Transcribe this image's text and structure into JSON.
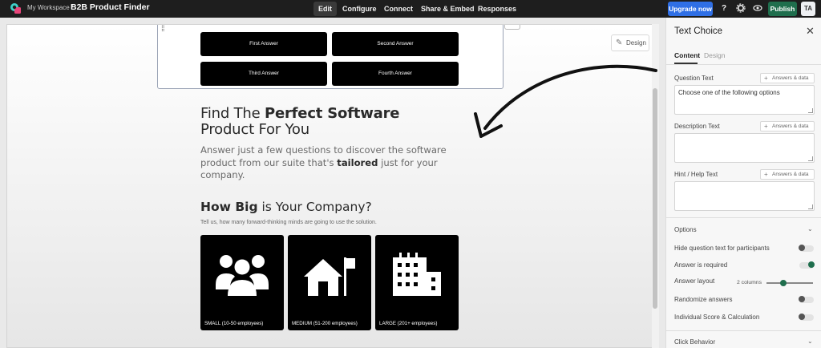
{
  "topbar": {
    "workspace": "My Workspace /",
    "title": "B2B Product Finder",
    "nav": [
      {
        "label": "Edit",
        "active": true
      },
      {
        "label": "Configure",
        "active": false
      },
      {
        "label": "Connect",
        "active": false
      },
      {
        "label": "Share & Embed",
        "active": false
      },
      {
        "label": "Responses",
        "active": false
      }
    ],
    "upgrade_label": "Upgrade now",
    "help_icon": "question-icon",
    "settings_icon": "gear-icon",
    "preview_icon": "eye-icon",
    "publish_label": "Publish",
    "avatar_initials": "TA",
    "accent_color": "#2f6fe5",
    "publish_color": "#1f6e4d"
  },
  "canvas": {
    "answers": [
      "First Answer",
      "Second Answer",
      "Third Answer",
      "Fourth Answer"
    ],
    "design_label": "Design",
    "headline_pre": "Find The ",
    "headline_bold": "Perfect Software",
    "headline_post": "Product For You",
    "subhead_pre": "Answer just a few questions to discover the software product from our suite that's ",
    "subhead_bold": "tailored",
    "subhead_post": " just for your company.",
    "question_bold": "How Big",
    "question_rest": " is Your Company?",
    "question_help": "Tell us, how many forward-thinking minds are going to use the solution.",
    "sizes": [
      {
        "label": "SMALL (10-50 employees)",
        "icon": "people-group-icon"
      },
      {
        "label": "MEDIUM (51-200 employees)",
        "icon": "house-flag-icon"
      },
      {
        "label": "LARGE (201+ employees)",
        "icon": "building-icon"
      }
    ]
  },
  "panel": {
    "title": "Text Choice",
    "tabs": [
      "Content",
      "Design"
    ],
    "chip_label": "Answers & data",
    "question_text_label": "Question Text",
    "question_text_value": "Choose one of the following options",
    "description_label": "Description Text",
    "hint_label": "Hint / Help Text",
    "options_title": "Options",
    "options": {
      "hide_question": {
        "label": "Hide question text for participants",
        "on": false
      },
      "required": {
        "label": "Answer is required",
        "on": true
      },
      "layout": {
        "label": "Answer layout",
        "value": "2 columns"
      },
      "randomize": {
        "label": "Randomize answers",
        "on": false
      },
      "score": {
        "label": "Individual Score & Calculation",
        "on": false
      }
    },
    "click_behavior_title": "Click Behavior"
  }
}
